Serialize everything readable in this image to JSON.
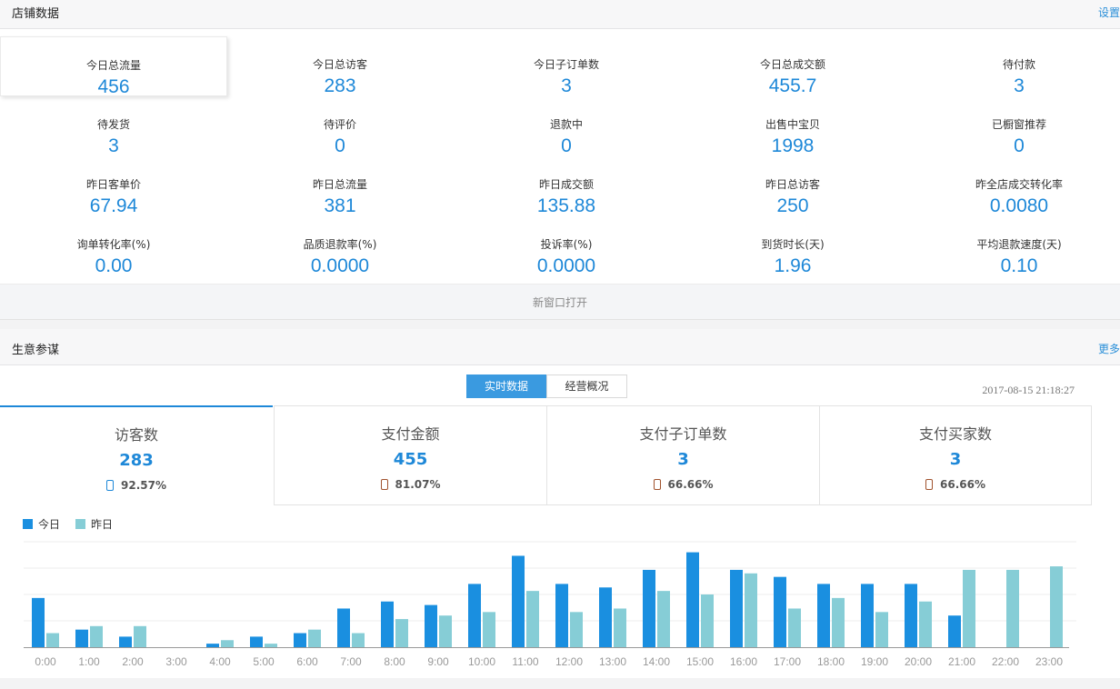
{
  "shop": {
    "title": "店铺数据",
    "settings_link": "设置",
    "open_window": "新窗口打开",
    "stats": [
      {
        "label": "今日总流量",
        "value": "456"
      },
      {
        "label": "今日总访客",
        "value": "283"
      },
      {
        "label": "今日子订单数",
        "value": "3"
      },
      {
        "label": "今日总成交额",
        "value": "455.7"
      },
      {
        "label": "待付款",
        "value": "3"
      },
      {
        "label": "待发货",
        "value": "3"
      },
      {
        "label": "待评价",
        "value": "0"
      },
      {
        "label": "退款中",
        "value": "0"
      },
      {
        "label": "出售中宝贝",
        "value": "1998"
      },
      {
        "label": "已橱窗推荐",
        "value": "0"
      },
      {
        "label": "昨日客单价",
        "value": "67.94"
      },
      {
        "label": "昨日总流量",
        "value": "381"
      },
      {
        "label": "昨日成交额",
        "value": "135.88"
      },
      {
        "label": "昨日总访客",
        "value": "250"
      },
      {
        "label": "昨全店成交转化率",
        "value": "0.0080"
      },
      {
        "label": "询单转化率(%)",
        "value": "0.00"
      },
      {
        "label": "品质退款率(%)",
        "value": "0.0000"
      },
      {
        "label": "投诉率(%)",
        "value": "0.0000"
      },
      {
        "label": "到货时长(天)",
        "value": "1.96"
      },
      {
        "label": "平均退款速度(天)",
        "value": "0.10"
      }
    ]
  },
  "business": {
    "title": "生意参谋",
    "more_link": "更多",
    "tabs": [
      {
        "label": "实时数据",
        "active": true
      },
      {
        "label": "经营概况",
        "active": false
      }
    ],
    "timestamp": "2017-08-15 21:18:27",
    "metrics": [
      {
        "label": "访客数",
        "value": "283",
        "pct": "92.57%",
        "icon": "mobile-icon",
        "icon_color": "#1e88d8"
      },
      {
        "label": "支付金额",
        "value": "455",
        "pct": "81.07%",
        "icon": "mobile-icon",
        "icon_color": "#a0522d"
      },
      {
        "label": "支付子订单数",
        "value": "3",
        "pct": "66.66%",
        "icon": "mobile-icon",
        "icon_color": "#a0522d"
      },
      {
        "label": "支付买家数",
        "value": "3",
        "pct": "66.66%",
        "icon": "mobile-icon",
        "icon_color": "#a0522d"
      }
    ]
  },
  "chart_data": {
    "type": "bar",
    "categories": [
      "0:00",
      "1:00",
      "2:00",
      "3:00",
      "4:00",
      "5:00",
      "6:00",
      "7:00",
      "8:00",
      "9:00",
      "10:00",
      "11:00",
      "12:00",
      "13:00",
      "14:00",
      "15:00",
      "16:00",
      "17:00",
      "18:00",
      "19:00",
      "20:00",
      "21:00",
      "22:00",
      "23:00"
    ],
    "series": [
      {
        "name": "今日",
        "color": "#1a8fe0",
        "values": [
          14,
          5,
          3,
          0,
          1,
          3,
          4,
          11,
          13,
          12,
          18,
          26,
          18,
          17,
          22,
          27,
          22,
          20,
          18,
          18,
          18,
          9,
          0,
          0
        ]
      },
      {
        "name": "昨日",
        "color": "#86cdd6",
        "values": [
          4,
          6,
          6,
          0,
          2,
          1,
          5,
          4,
          8,
          9,
          10,
          16,
          10,
          11,
          16,
          15,
          21,
          11,
          14,
          10,
          13,
          22,
          22,
          23
        ]
      }
    ],
    "ylim": [
      0,
      30
    ],
    "grid": true,
    "legend": "top-left"
  }
}
